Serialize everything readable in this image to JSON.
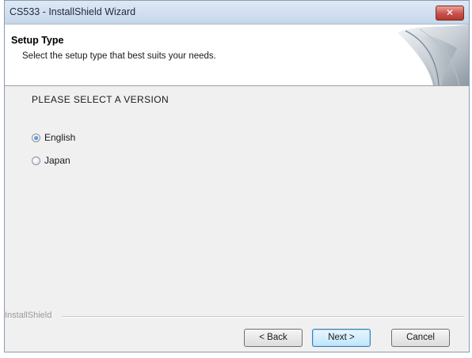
{
  "window": {
    "title": "CS533 - InstallShield Wizard",
    "close_glyph": "✕"
  },
  "header": {
    "title": "Setup Type",
    "subtitle": "Select the setup type that best suits your needs."
  },
  "content": {
    "section_label": "PLEASE SELECT A VERSION",
    "options": [
      {
        "label": "English",
        "selected": true
      },
      {
        "label": "Japan",
        "selected": false
      }
    ]
  },
  "footer": {
    "brand": "InstallShield",
    "buttons": {
      "back": "< Back",
      "next": "Next >",
      "cancel": "Cancel"
    }
  },
  "colors": {
    "close_button": "#c75050",
    "default_button_border": "#3c7fb1"
  }
}
